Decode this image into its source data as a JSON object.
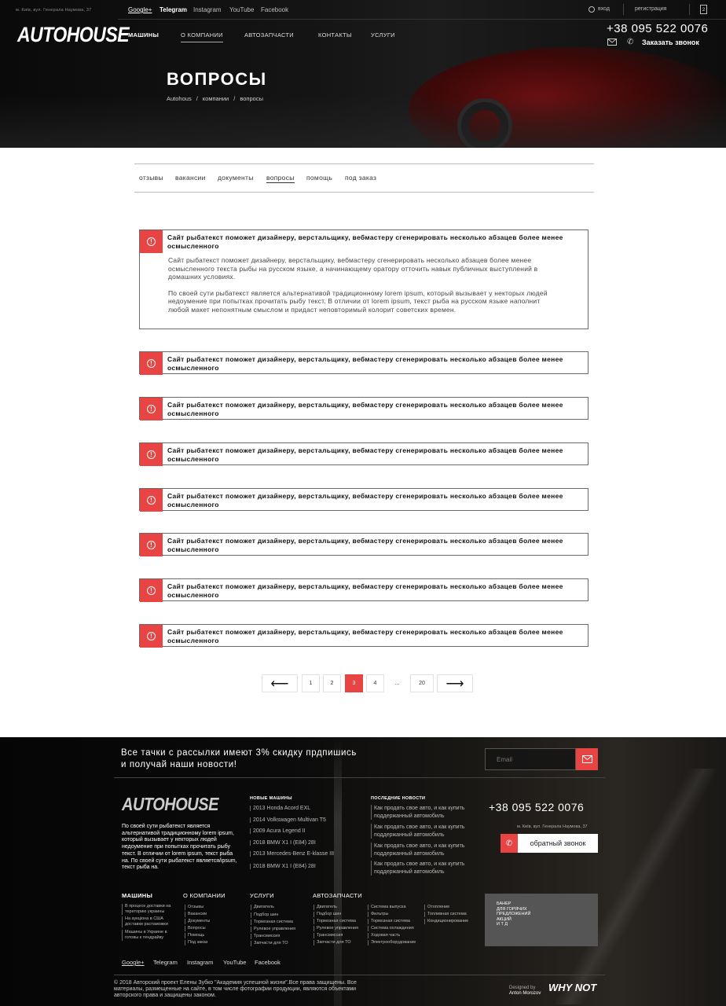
{
  "header": {
    "address": "м. Київ, вул. Генерала Наумова, 37",
    "social": [
      "Google+",
      "Telegram",
      "Instagram",
      "YouTube",
      "Facebook"
    ],
    "login": "вход",
    "register": "регистрация",
    "cart_count": "2",
    "logo": "AUTOHOUSE",
    "nav": [
      "МАШИНЫ",
      "О КОМПАНИИ",
      "АВТОЗАПЧАСТИ",
      "КОНТАКТЫ",
      "УСЛУГИ"
    ],
    "phone": "+38 095 522 0076",
    "callback": "Заказать звонок"
  },
  "hero": {
    "title": "ВОПРОСЫ",
    "breadcrumb": [
      "Autohous",
      "/",
      "компании",
      "/",
      "вопросы"
    ]
  },
  "tabs": [
    "отзывы",
    "вакансии",
    "документы",
    "вопросы",
    "помощь",
    "под заказ"
  ],
  "faq": {
    "question": "Сайт рыбатекст поможет дизайнеру, верстальщику, вебмастеру сгенерировать несколько абзацев более менее осмысленного",
    "answer_p1": "Сайт рыбатекст поможет дизайнеру, верстальщику, вебмастеру сгенерировать несколько абзацев более менее осмысленного текста рыбы на русском языке, а начинающему оратору отточить навык публичных выступлений в домашних условиях.",
    "answer_p2": "По своей сути рыбатекст является альтернативой традиционному lorem ipsum, который вызывает у некторых людей недоумение при попытках прочитать рыбу текст. В отличии от lorem ipsum, текст рыба на русском языке наполнит любой макет непонятным смыслом и придаст неповторимый колорит советских времен.",
    "icon": "alert-circle-icon"
  },
  "pagination": {
    "prev": "⟵",
    "pages": [
      "1",
      "2",
      "3",
      "4",
      "...",
      "20"
    ],
    "active": "3",
    "next": "⟶"
  },
  "footer": {
    "subscribe_text": "Все тачки с рассылки имеют 3% скидку прдпишись и получай наши новости!",
    "email_placeholder": "Email",
    "logo": "AUTOHOUSE",
    "description": "По своей сути рыбатекст является альтернативой традиционному lorem ipsum, который вызывает у некторых людей недоумение при попытках прочитать рыбу текст. В отличии от lorem ipsum, текст рыба на. По своей сути рыбатекст является/ipsum, текст рыба на.",
    "new_cars_title": "НОВЫЕ МАШИНЫ",
    "new_cars": [
      "2013 Honda Acord EXL",
      "2014 Volkswagen Multivan T5",
      "2009 Acura Legend II",
      "2018 BMW X1 I (E84) 28I",
      "2013 Mercedes-Benz E-klasse III",
      "2018 BMW X1 I (E84) 28I"
    ],
    "news_title": "ПОСЛЕДНИЕ НОВОСТИ",
    "news": [
      "Как продать свое авто, и как купить поддержанный автомобиль",
      "Как продать свое авто, и как купить поддержанный автомобиль",
      "Как продать свое авто, и как купить поддержанный автомобиль",
      "Как продать свое авто, и как купить поддержанный автомобиль"
    ],
    "phone": "+38 095 522 0076",
    "address": "м. Київ, вул. Генерала Наумова, 37",
    "callback": "обратный звонок",
    "cols": {
      "cars_title": "МАШИНЫ",
      "cars": [
        "В процесе доставки на терeторию украины",
        "На аукціона в США доставки растаможки",
        "Машины в Украине в готовы к тендрайву"
      ],
      "company_title": "О КОМПАНИИ",
      "company": [
        "Отзывы",
        "Вакансии",
        "Документы",
        "Вопросы",
        "Помощь",
        "Под заказ"
      ],
      "services_title": "УСЛУГИ",
      "services": [
        "Двигатель",
        "Подбор шин",
        "Тормозная система",
        "Рулевое управления",
        "Трансмиссия",
        "Запчасти для ТО"
      ],
      "parts_title": "АВТОЗАПЧАСТИ",
      "parts_a": [
        "Двигатель",
        "Подбор шин",
        "Тормозная система",
        "Рулевое управления",
        "Трансмиссия",
        "Запчасти для ТО"
      ],
      "parts_b": [
        "Система выпуска",
        "Фильтры",
        "Тормозная система",
        "Система охлаждения",
        "Ходовая часть",
        "Электрооборудование"
      ],
      "parts_c": [
        "Отопление",
        "Топливная система",
        "Кондиционирование"
      ]
    },
    "banner": [
      "БАНЕР",
      "ДЛЯ ГОРЯЧИХ",
      "ПРЕДЛОЖЕНИЙ",
      "АКЦИЙ",
      "И Т Д"
    ],
    "social": [
      "Google+",
      "Telegram",
      "Instagram",
      "YouTube",
      "Facebook"
    ],
    "copyright": "© 2018 Авторский проект Елены Зубко \"Академия успешной жизни\".Все права защищены. Все материалы, размещенные на сайте, в том числе фотографии продукции, являются объектами авторского права и защищены законом.",
    "designed_by": "Designed by",
    "designer": "Anton Morozov",
    "designer_logo": "WHY NOT"
  },
  "colors": {
    "accent": "#e84444",
    "dark": "#0a0a0a"
  }
}
